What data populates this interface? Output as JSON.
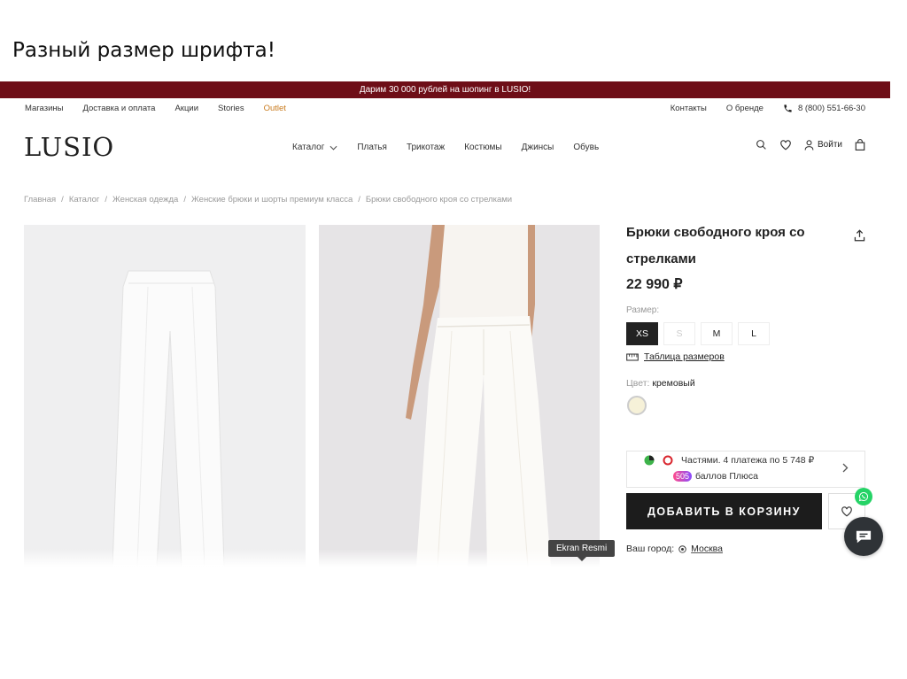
{
  "slide": {
    "title": "Разный размер шрифта!"
  },
  "promo": {
    "text": "Дарим 30 000 рублей на шопинг в LUSIO!"
  },
  "utility_nav": {
    "left": [
      "Магазины",
      "Доставка и оплата",
      "Акции",
      "Stories",
      "Outlet"
    ],
    "contacts": "Контакты",
    "about": "О бренде",
    "phone": "8 (800) 551-66-30"
  },
  "header": {
    "logo": "LUSIO",
    "nav": [
      "Каталог",
      "Платья",
      "Трикотаж",
      "Костюмы",
      "Джинсы",
      "Обувь"
    ],
    "login": "Войти"
  },
  "breadcrumbs": [
    "Главная",
    "Каталог",
    "Женская одежда",
    "Женские брюки и шорты премиум класса",
    "Брюки свободного кроя со стрелками"
  ],
  "product": {
    "title": "Брюки свободного кроя со стрелками",
    "price": "22 990 ₽",
    "size_label": "Размер:",
    "sizes": [
      "XS",
      "S",
      "M",
      "L"
    ],
    "selected_size": "XS",
    "size_table": "Таблица размеров",
    "color_label": "Цвет:",
    "color_value": "кремовый",
    "swatch_color": "#f6f1d8",
    "installments": "Частями. 4 платежа по 5 748 ₽",
    "plus_points": "505",
    "plus_text": "баллов Плюса",
    "add_to_cart": "ДОБАВИТЬ В КОРЗИНУ",
    "city_label": "Ваш город:",
    "city": "Москва"
  },
  "tooltip": {
    "text": "Ekran Resmi"
  },
  "colors": {
    "promo_bg": "#6e0e17",
    "outlet": "#c97a1c",
    "button": "#1c1c1c",
    "whatsapp": "#25d366"
  }
}
